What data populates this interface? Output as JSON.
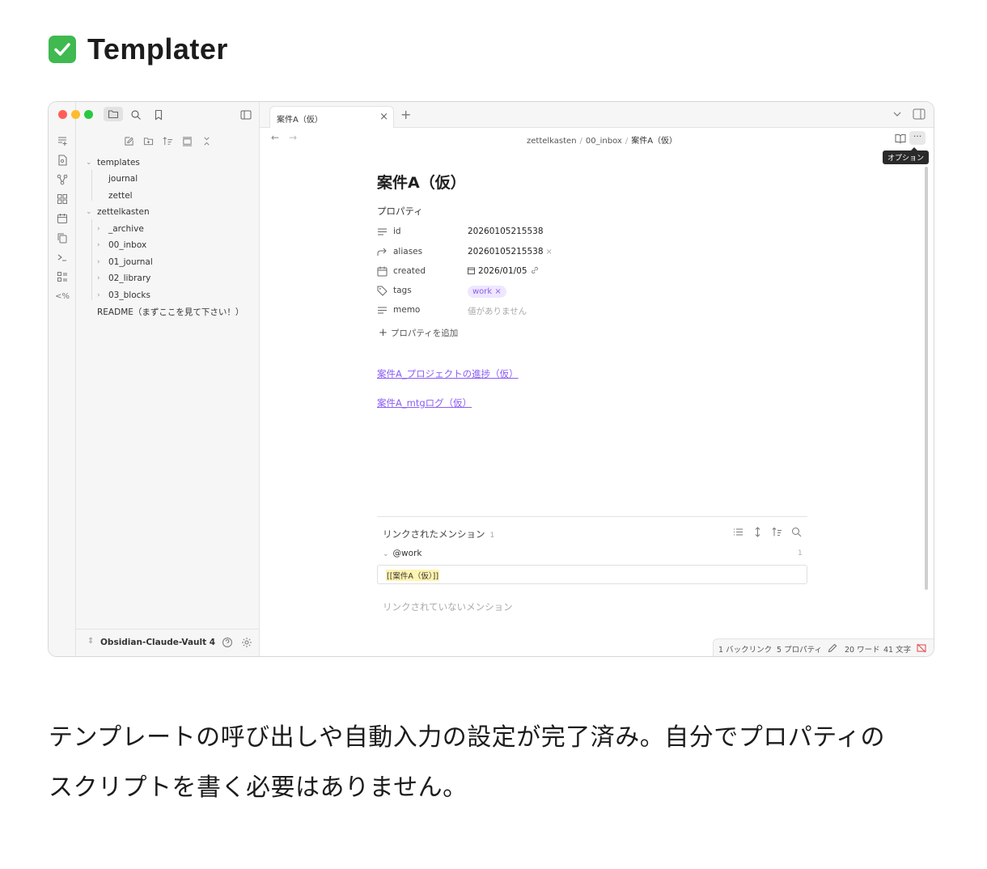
{
  "heading": {
    "emoji": "✅",
    "title": "Templater"
  },
  "app": {
    "tab": {
      "label": "案件A（仮）"
    },
    "breadcrumb": {
      "part1": "zettelkasten",
      "sep": "/",
      "part2": "00_inbox",
      "current": "案件A（仮）"
    },
    "tooltip": "オプション",
    "more_glyph": "···",
    "sidebar": {
      "tree": [
        {
          "label": "templates",
          "kind": "folder-open"
        },
        {
          "label": "journal",
          "kind": "file"
        },
        {
          "label": "zettel",
          "kind": "file"
        },
        {
          "label": "zettelkasten",
          "kind": "folder-open"
        },
        {
          "label": "_archive",
          "kind": "folder"
        },
        {
          "label": "00_inbox",
          "kind": "folder"
        },
        {
          "label": "01_journal",
          "kind": "folder"
        },
        {
          "label": "02_library",
          "kind": "folder"
        },
        {
          "label": "03_blocks",
          "kind": "folder"
        },
        {
          "label": "README（まずここを見て下さい！）",
          "kind": "file"
        }
      ],
      "vault_name": "Obsidian-Claude-Vault 4"
    },
    "note": {
      "title": "案件A（仮）",
      "properties_heading": "プロパティ",
      "properties": {
        "id": {
          "key": "id",
          "value": "20260105215538"
        },
        "aliases": {
          "key": "aliases",
          "value": "20260105215538"
        },
        "created": {
          "key": "created",
          "value": "2026/01/05"
        },
        "tags": {
          "key": "tags",
          "value": "work"
        },
        "memo": {
          "key": "memo",
          "value": "値がありません"
        }
      },
      "remove_glyph": "×",
      "add_property": "プロパティを追加",
      "links": [
        "案件A_プロジェクトの進捗（仮）",
        "案件A_mtgログ（仮）"
      ]
    },
    "mentions": {
      "title": "リンクされたメンション",
      "count": "1",
      "group": "@work",
      "group_count": "1",
      "snippet": "[[案件A（仮）]]",
      "unlinked": "リンクされていないメンション"
    },
    "status": {
      "backlinks": "1 バックリンク",
      "properties": "5 プロパティ",
      "words": "20 ワード",
      "chars": "41 文字"
    },
    "colors": {
      "accent": "#8a5cf5",
      "red": "#ff5f57",
      "yellow": "#febc2e",
      "green": "#28c840"
    }
  },
  "caption": {
    "line1": "テンプレートの呼び出しや自動入力の設定が完了済み。自分でプロパティの",
    "line2": "スクリプトを書く必要はありません。"
  }
}
